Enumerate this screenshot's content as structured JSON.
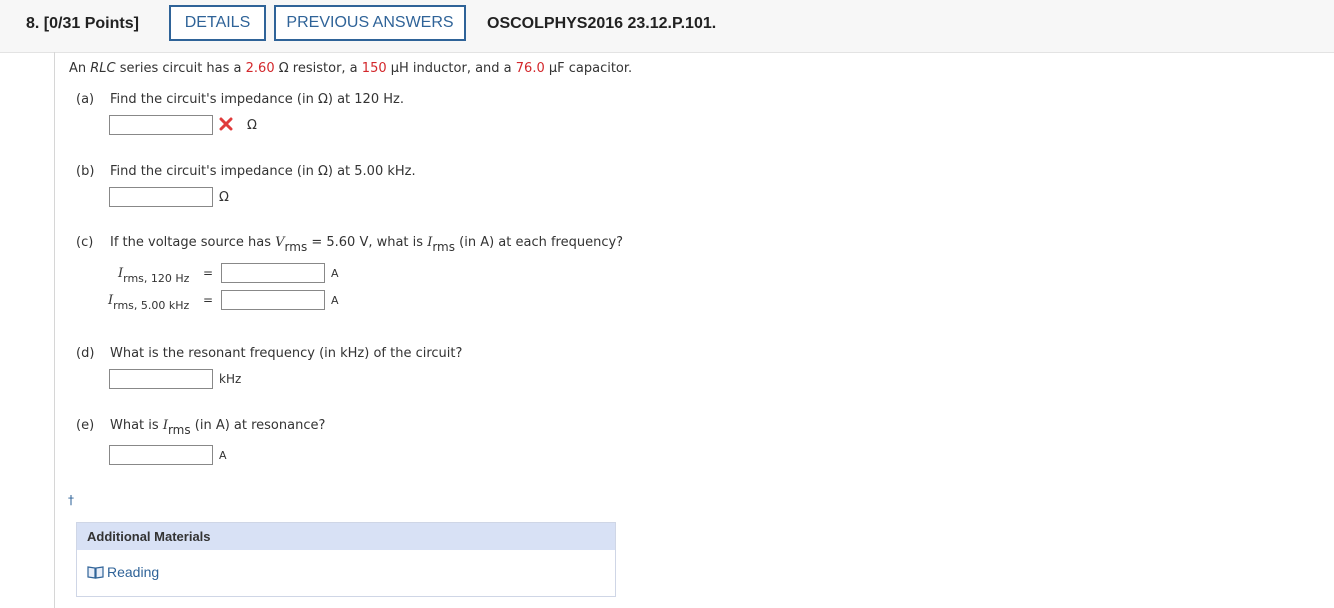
{
  "header": {
    "question_number": "8.",
    "points": "[0/31 Points]",
    "details_label": "DETAILS",
    "previous_answers_label": "PREVIOUS ANSWERS",
    "problem_code": "OSCOLPHYS2016 23.12.P.101."
  },
  "problem": {
    "intro_prefix": "An ",
    "intro_italic": "RLC",
    "intro_part1": " series circuit has a ",
    "resistance": "2.60",
    "intro_part2": " Ω resistor, a ",
    "inductance": "150",
    "intro_part3": " μH inductor, and a ",
    "capacitance": "76.0",
    "intro_part4": " μF capacitor."
  },
  "parts": {
    "a": {
      "label": "(a)",
      "text": "Find the circuit's impedance (in Ω) at 120 Hz.",
      "unit": "Ω",
      "value": ""
    },
    "b": {
      "label": "(b)",
      "text": "Find the circuit's impedance (in Ω) at 5.00 kHz.",
      "unit": "Ω",
      "value": ""
    },
    "c": {
      "label": "(c)",
      "text1": "If the voltage source has ",
      "v_symbol": "V",
      "v_sub": "rms",
      "text2": " = 5.60 V, what is ",
      "i_symbol": "I",
      "i_sub": "rms",
      "text3": " (in A) at each frequency?",
      "row1_symbol": "I",
      "row1_sub": "rms, 120 Hz",
      "row2_symbol": "I",
      "row2_sub": "rms, 5.00 kHz",
      "equals": "=",
      "unit": "A"
    },
    "d": {
      "label": "(d)",
      "text": "What is the resonant frequency (in kHz) of the circuit?",
      "unit": "kHz"
    },
    "e": {
      "label": "(e)",
      "text1": "What is ",
      "i_symbol": "I",
      "i_sub": "rms",
      "text2": " (in A) at resonance?",
      "unit": "A"
    }
  },
  "footer": {
    "dagger": "†",
    "additional_materials": "Additional Materials",
    "reading_label": "Reading"
  },
  "colors": {
    "accent": "#2f6398",
    "highlight": "#d3272b",
    "materials_header": "#d8e1f5"
  }
}
